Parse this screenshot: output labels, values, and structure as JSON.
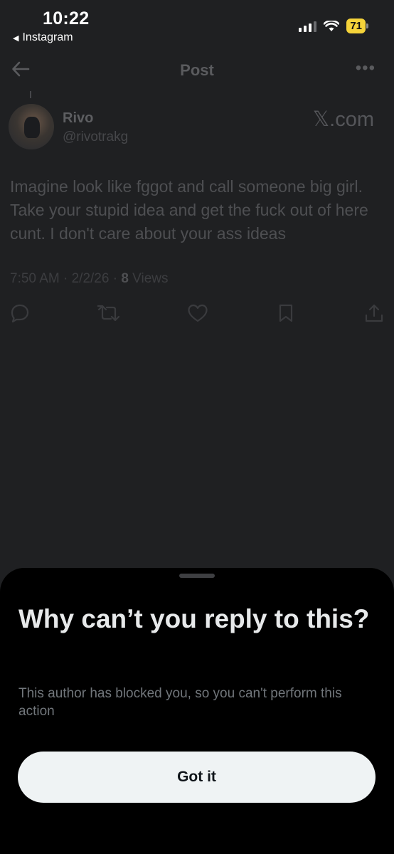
{
  "status_bar": {
    "time": "10:22",
    "back_app": "Instagram",
    "battery": "71"
  },
  "nav": {
    "title": "Post",
    "back_icon": "arrow-left-icon",
    "more_icon": "more-horizontal-icon"
  },
  "post": {
    "author_name": "Rivo",
    "author_handle": "@rivotrakg",
    "source_label": "𝕏.com",
    "text": "Imagine look like fggot and call someone big girl. Take your stupid idea and get the fuck out of here cunt. I don't care about your ass ideas",
    "timestamp": "7:50 AM · 2/2/26 · ",
    "views_count": "8",
    "views_label": " Views",
    "actions": [
      "reply-icon",
      "repost-icon",
      "like-icon",
      "bookmark-icon",
      "share-icon"
    ]
  },
  "sheet": {
    "title": "Why can’t you reply to this?",
    "body": "This author has blocked you, so you can't perform this action",
    "button_label": "Got it"
  },
  "colors": {
    "background_dimmed": "#1f2022",
    "sheet_background": "#000000",
    "button_background": "#eff3f4",
    "battery_yellow": "#f5d33a"
  }
}
